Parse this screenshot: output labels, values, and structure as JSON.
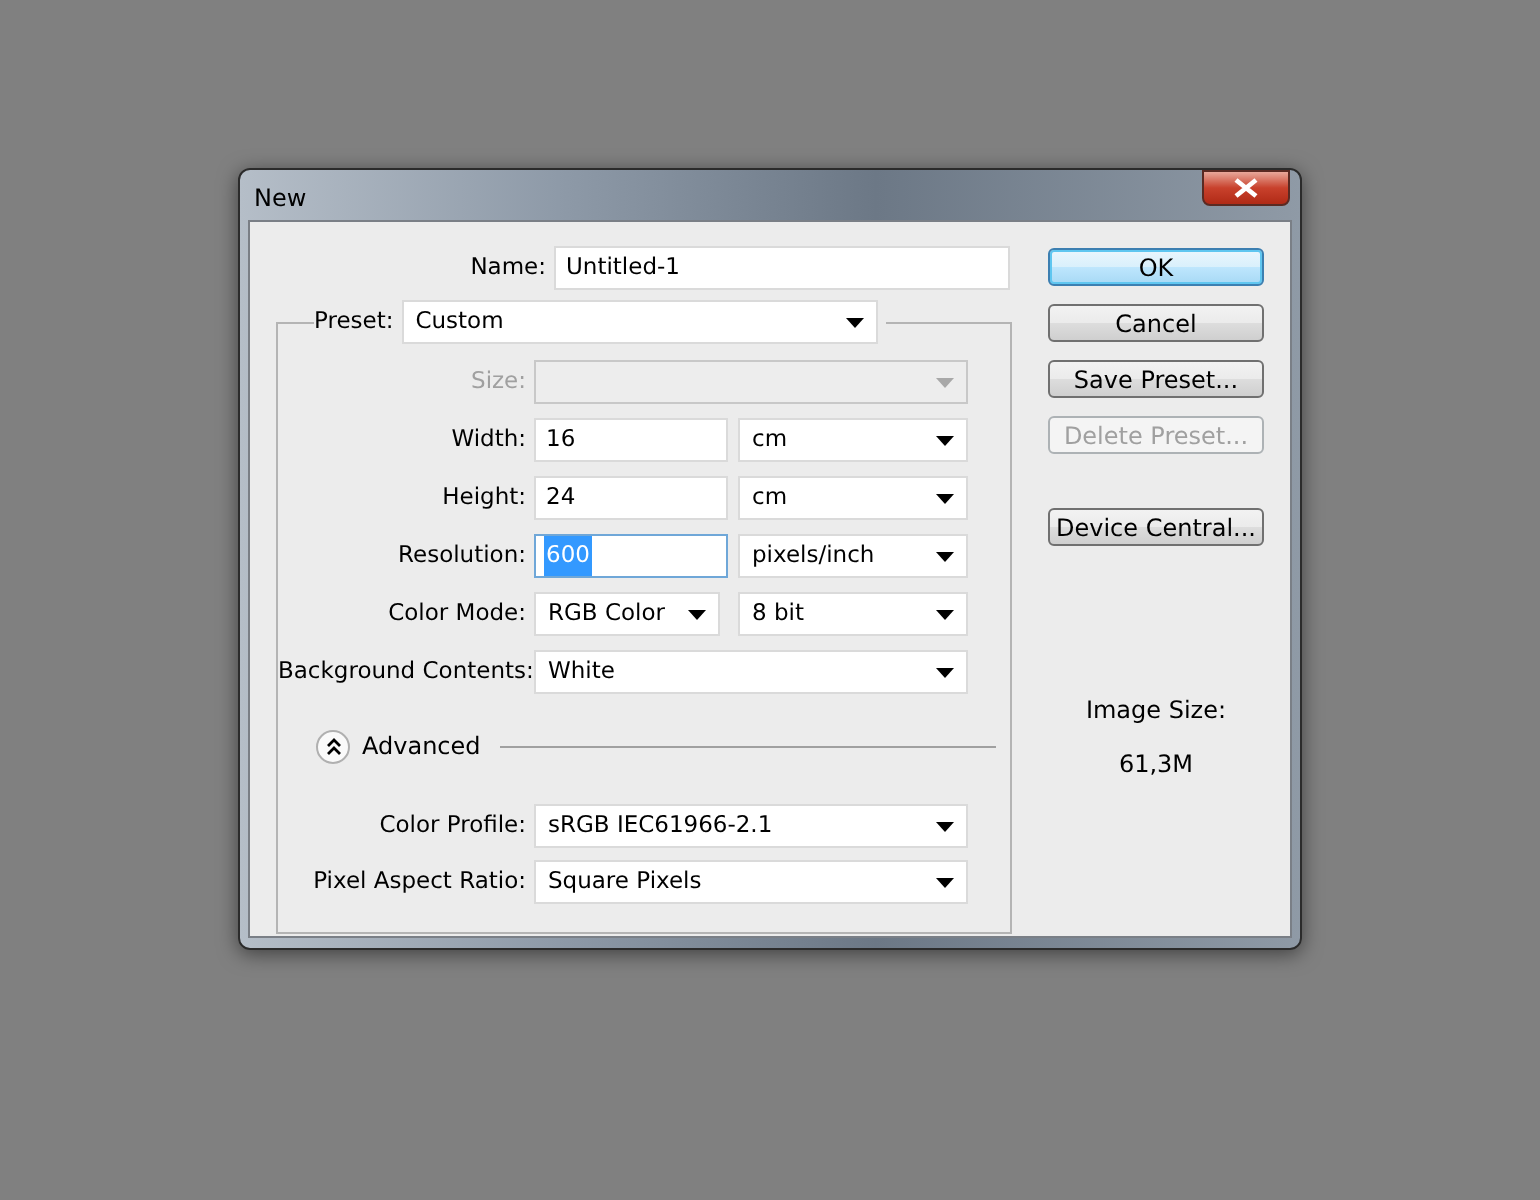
{
  "window": {
    "title": "New"
  },
  "name": {
    "label": "Name:",
    "value": "Untitled-1"
  },
  "preset": {
    "label": "Preset:",
    "value": "Custom"
  },
  "fields": [
    {
      "kind": "select",
      "label": "Size:",
      "disabled": true
    },
    {
      "kind": "pair",
      "label": "Width:",
      "value": "16",
      "unit": "cm",
      "disabled": false,
      "highlighted": false
    },
    {
      "kind": "pair",
      "label": "Height:",
      "value": "24",
      "unit": "cm",
      "disabled": false,
      "highlighted": false
    },
    {
      "kind": "pair",
      "label": "Resolution:",
      "value": "600",
      "unit": "pixels/inch",
      "disabled": false,
      "highlighted": true
    },
    {
      "kind": "select_pair",
      "label": "Color Mode:",
      "value": "RGB Color",
      "unit": "8 bit",
      "disabled": false
    },
    {
      "kind": "select",
      "label": "Background Contents:",
      "value": "White",
      "disabled": false
    }
  ],
  "advanced": {
    "label": "Advanced",
    "expanded": true,
    "fields": [
      {
        "label": "Color Profile:",
        "value": "sRGB IEC61966-2.1"
      },
      {
        "label": "Pixel Aspect Ratio:",
        "value": "Square Pixels"
      }
    ]
  },
  "buttons": [
    {
      "label": "OK",
      "default": true,
      "disabled": false
    },
    {
      "label": "Cancel",
      "default": false,
      "disabled": false
    },
    {
      "label": "Save Preset...",
      "default": false,
      "disabled": false
    },
    {
      "label": "Delete Preset...",
      "default": false,
      "disabled": true
    },
    {
      "label": "Device Central...",
      "default": false,
      "disabled": false
    }
  ],
  "image_size": {
    "label": "Image Size:",
    "value": "61,3M"
  }
}
